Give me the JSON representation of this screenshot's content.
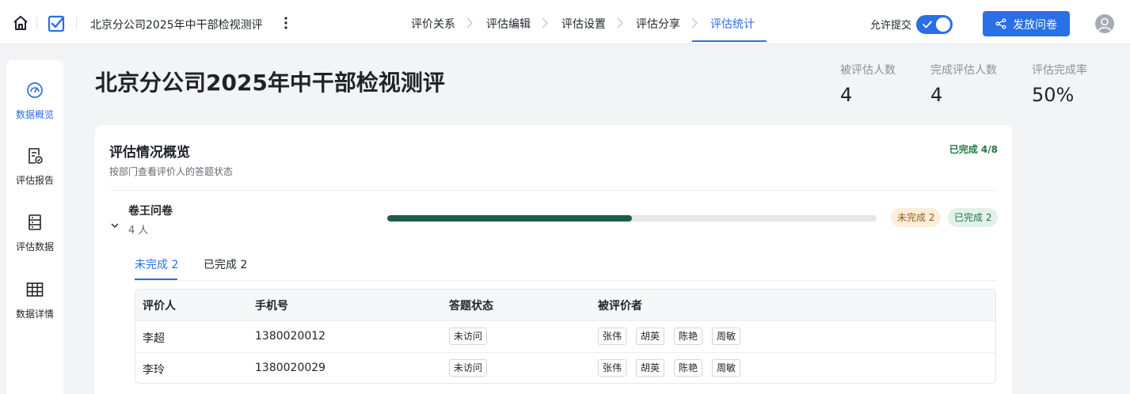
{
  "topbar": {
    "survey_title": "北京分公司2025年中干部检视测评",
    "steps": [
      "评价关系",
      "评估编辑",
      "评估设置",
      "评估分享",
      "评估统计"
    ],
    "active_step": "评估统计",
    "allow_submit_label": "允许提交",
    "allow_submit_on": true,
    "publish_label": "发放问卷",
    "accent_color": "#2a6ee8"
  },
  "sidebar": {
    "items": [
      {
        "label": "数据概览",
        "icon": "dashboard-icon",
        "active": true
      },
      {
        "label": "评估报告",
        "icon": "report-icon",
        "active": false
      },
      {
        "label": "评估数据",
        "icon": "data-sheet-icon",
        "active": false
      },
      {
        "label": "数据详情",
        "icon": "grid-table-icon",
        "active": false
      }
    ]
  },
  "main": {
    "title": "北京分公司2025年中干部检视测评",
    "stats": [
      {
        "label": "被评估人数",
        "value": "4"
      },
      {
        "label": "完成评估人数",
        "value": "4"
      },
      {
        "label": "评估完成率",
        "value": "50%"
      }
    ]
  },
  "card": {
    "title": "评估情况概览",
    "subtitle": "按部门查看评价人的答题状态",
    "completed_summary": "已完成 4/8",
    "questionnaire": {
      "name": "卷王问卷",
      "count": "4 人",
      "progress": 0.5,
      "pending_label": "未完成 2",
      "done_label": "已完成 2"
    },
    "tabs": [
      "未完成 2",
      "已完成 2"
    ],
    "table": {
      "headers": [
        "评价人",
        "手机号",
        "答题状态",
        "被评价者"
      ],
      "rows": [
        {
          "rater": "李超",
          "phone": "1380020012",
          "status": "未访问",
          "ratees": [
            "张伟",
            "胡英",
            "陈艳",
            "周敏"
          ]
        },
        {
          "rater": "李玲",
          "phone": "1380020029",
          "status": "未访问",
          "ratees": [
            "张伟",
            "胡英",
            "陈艳",
            "周敏"
          ]
        }
      ]
    }
  }
}
